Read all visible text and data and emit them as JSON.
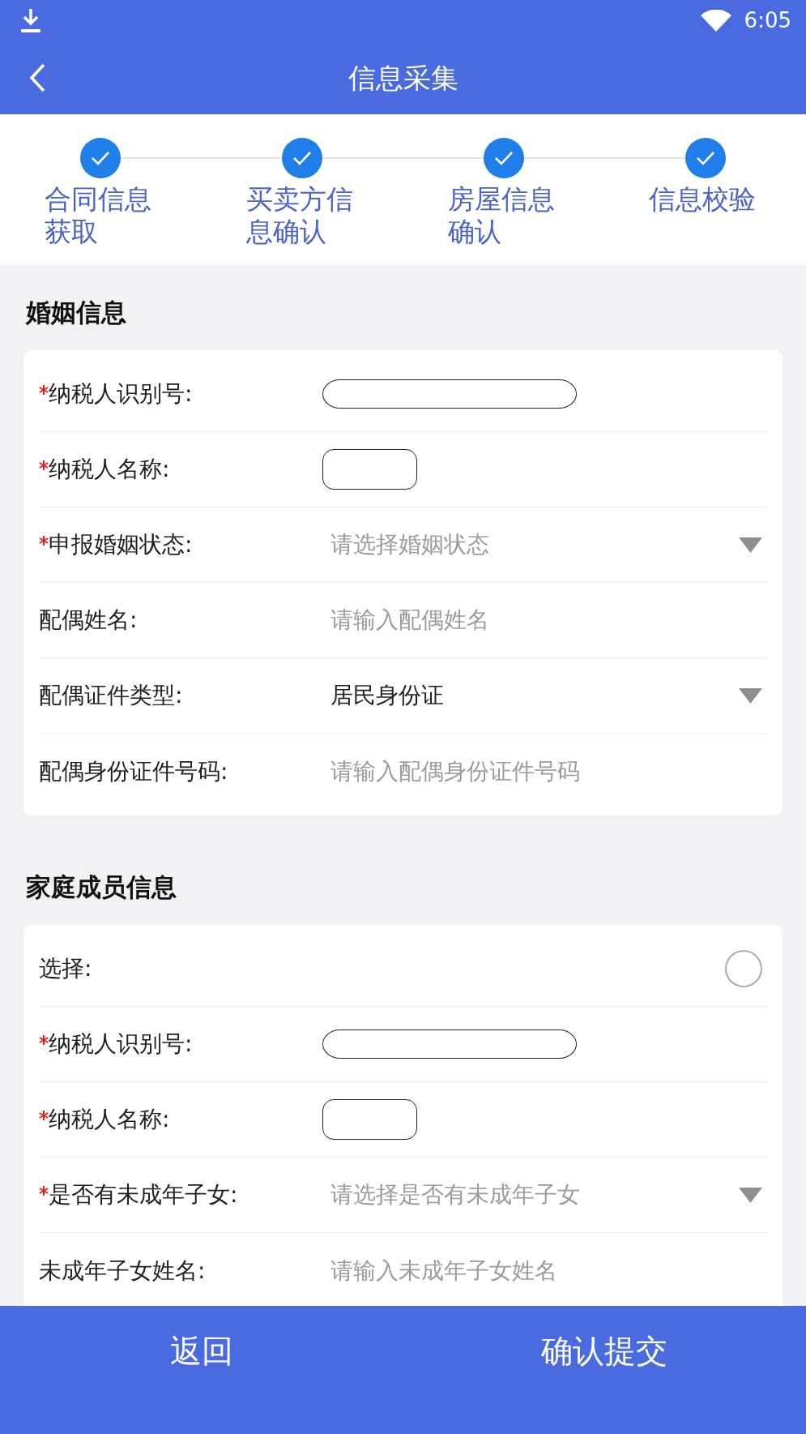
{
  "status_bar": {
    "time": "6:05"
  },
  "header": {
    "title": "信息采集"
  },
  "steps": [
    {
      "label": "合同信息获取",
      "done": true
    },
    {
      "label": "买卖方信息确认",
      "done": true
    },
    {
      "label": "房屋信息确认",
      "done": true
    },
    {
      "label": "信息校验",
      "done": true
    }
  ],
  "sections": [
    {
      "title": "婚姻信息",
      "rows": [
        {
          "label": "纳税人识别号:",
          "required": true,
          "kind": "redacted"
        },
        {
          "label": "纳税人名称:",
          "required": true,
          "kind": "redacted"
        },
        {
          "label": "申报婚姻状态:",
          "required": true,
          "kind": "select",
          "placeholder": "请选择婚姻状态"
        },
        {
          "label": "配偶姓名:",
          "required": false,
          "kind": "input",
          "placeholder": "请输入配偶姓名"
        },
        {
          "label": "配偶证件类型:",
          "required": false,
          "kind": "select",
          "value": "居民身份证"
        },
        {
          "label": "配偶身份证件号码:",
          "required": false,
          "kind": "input",
          "placeholder": "请输入配偶身份证件号码"
        }
      ]
    },
    {
      "title": "家庭成员信息",
      "rows": [
        {
          "label": "选择:",
          "required": false,
          "kind": "radio",
          "selected": false
        },
        {
          "label": "纳税人识别号:",
          "required": true,
          "kind": "redacted"
        },
        {
          "label": "纳税人名称:",
          "required": true,
          "kind": "redacted"
        },
        {
          "label": "是否有未成年子女:",
          "required": true,
          "kind": "select",
          "placeholder": "请选择是否有未成年子女"
        },
        {
          "label": "未成年子女姓名:",
          "required": false,
          "kind": "input",
          "placeholder": "请输入未成年子女姓名"
        }
      ]
    }
  ],
  "footer": {
    "back_button": "返回",
    "submit_button": "确认提交"
  }
}
